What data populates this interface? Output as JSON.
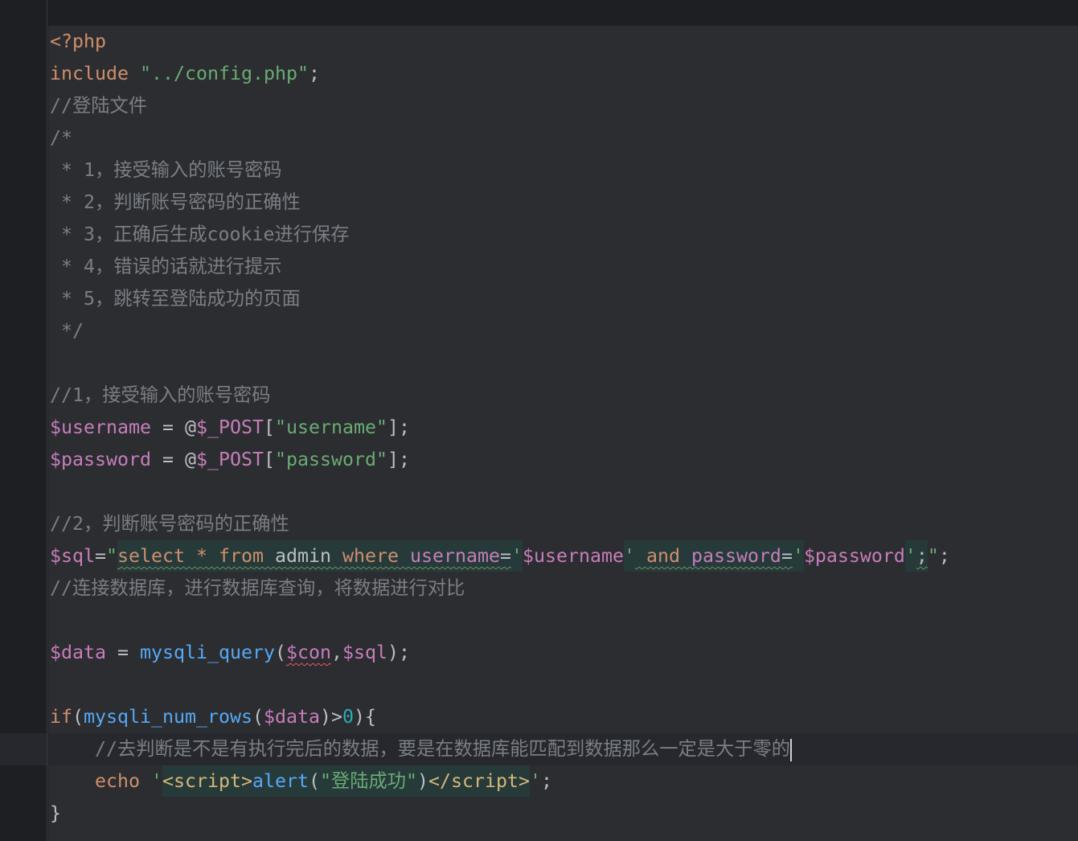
{
  "theme": {
    "outer_bg": "#1e1f22",
    "editor_bg": "#2b2d30",
    "current_line_bg": "#26282e",
    "caret": "#ced0d6",
    "gutter_border": "#393b40"
  },
  "editor": {
    "lines": [
      {
        "tokens": [
          {
            "text": "<?php",
            "fg": "#cf8e6d"
          }
        ]
      },
      {
        "tokens": [
          {
            "text": "include",
            "fg": "#cf8e6d"
          },
          {
            "text": " ",
            "fg": "#bcbec4"
          },
          {
            "text": "\"../config.php\"",
            "fg": "#6aab73"
          },
          {
            "text": ";",
            "fg": "#bcbec4"
          }
        ]
      },
      {
        "tokens": [
          {
            "text": "//登陆文件",
            "fg": "#7a7e85"
          }
        ]
      },
      {
        "tokens": [
          {
            "text": "/*",
            "fg": "#7a7e85"
          }
        ]
      },
      {
        "tokens": [
          {
            "text": " * 1，接受输入的账号密码",
            "fg": "#7a7e85"
          }
        ]
      },
      {
        "tokens": [
          {
            "text": " * 2，判断账号密码的正确性",
            "fg": "#7a7e85"
          }
        ]
      },
      {
        "tokens": [
          {
            "text": " * 3，正确后生成cookie进行保存",
            "fg": "#7a7e85"
          }
        ]
      },
      {
        "tokens": [
          {
            "text": " * 4，错误的话就进行提示",
            "fg": "#7a7e85"
          }
        ]
      },
      {
        "tokens": [
          {
            "text": " * 5，跳转至登陆成功的页面",
            "fg": "#7a7e85"
          }
        ]
      },
      {
        "tokens": [
          {
            "text": " */",
            "fg": "#7a7e85"
          }
        ]
      },
      {
        "tokens": []
      },
      {
        "tokens": [
          {
            "text": "//1，接受输入的账号密码",
            "fg": "#7a7e85"
          }
        ]
      },
      {
        "tokens": [
          {
            "text": "$username",
            "fg": "#c77dbb"
          },
          {
            "text": " = @",
            "fg": "#bcbec4"
          },
          {
            "text": "$_POST",
            "fg": "#c77dbb"
          },
          {
            "text": "[",
            "fg": "#bcbec4"
          },
          {
            "text": "\"username\"",
            "fg": "#6aab73"
          },
          {
            "text": "];",
            "fg": "#bcbec4"
          }
        ]
      },
      {
        "tokens": [
          {
            "text": "$password",
            "fg": "#c77dbb"
          },
          {
            "text": " = @",
            "fg": "#bcbec4"
          },
          {
            "text": "$_POST",
            "fg": "#c77dbb"
          },
          {
            "text": "[",
            "fg": "#bcbec4"
          },
          {
            "text": "\"password\"",
            "fg": "#6aab73"
          },
          {
            "text": "];",
            "fg": "#bcbec4"
          }
        ]
      },
      {
        "tokens": []
      },
      {
        "tokens": [
          {
            "text": "//2，判断账号密码的正确性",
            "fg": "#7a7e85"
          }
        ]
      },
      {
        "tokens": [
          {
            "text": "$sql",
            "fg": "#c77dbb"
          },
          {
            "text": "=",
            "fg": "#bcbec4"
          },
          {
            "text": "\"",
            "fg": "#6aab73"
          },
          {
            "text": "select",
            "fg": "#cf8e6d",
            "bg": "#263a3a",
            "wavy": "#6f8f62"
          },
          {
            "text": " ",
            "fg": "#bcbec4",
            "bg": "#263a3a",
            "wavy": "#6f8f62"
          },
          {
            "text": "*",
            "fg": "#cf8e6d",
            "bg": "#263a3a",
            "wavy": "#6f8f62"
          },
          {
            "text": " ",
            "fg": "#bcbec4",
            "bg": "#263a3a",
            "wavy": "#6f8f62"
          },
          {
            "text": "from",
            "fg": "#cf8e6d",
            "bg": "#263a3a",
            "wavy": "#6f8f62"
          },
          {
            "text": " admin ",
            "fg": "#bcbec4",
            "bg": "#263a3a",
            "wavy": "#6f8f62"
          },
          {
            "text": "where",
            "fg": "#cf8e6d",
            "bg": "#263a3a",
            "wavy": "#6f8f62"
          },
          {
            "text": " ",
            "fg": "#bcbec4",
            "bg": "#263a3a",
            "wavy": "#6f8f62"
          },
          {
            "text": "username",
            "fg": "#c77dbb",
            "bg": "#263a3a",
            "wavy": "#6f8f62"
          },
          {
            "text": "=",
            "fg": "#bcbec4",
            "bg": "#263a3a",
            "wavy": "#6f8f62"
          },
          {
            "text": "'",
            "fg": "#6aab73",
            "bg": "#263a3a"
          },
          {
            "text": "$username",
            "fg": "#c77dbb"
          },
          {
            "text": "'",
            "fg": "#6aab73",
            "bg": "#263a3a"
          },
          {
            "text": " ",
            "fg": "#bcbec4",
            "bg": "#263a3a",
            "wavy": "#6f8f62"
          },
          {
            "text": "and",
            "fg": "#cf8e6d",
            "bg": "#263a3a",
            "wavy": "#6f8f62"
          },
          {
            "text": " ",
            "fg": "#bcbec4",
            "bg": "#263a3a",
            "wavy": "#6f8f62"
          },
          {
            "text": "password",
            "fg": "#c77dbb",
            "bg": "#263a3a",
            "wavy": "#6f8f62"
          },
          {
            "text": "=",
            "fg": "#bcbec4",
            "bg": "#263a3a",
            "wavy": "#6f8f62"
          },
          {
            "text": "'",
            "fg": "#6aab73",
            "bg": "#263a3a"
          },
          {
            "text": "$password",
            "fg": "#c77dbb"
          },
          {
            "text": "'",
            "fg": "#6aab73",
            "bg": "#263a3a"
          },
          {
            "text": ";",
            "fg": "#bcbec4",
            "bg": "#263a3a",
            "wavy": "#6f8f62"
          },
          {
            "text": "\"",
            "fg": "#6aab73"
          },
          {
            "text": ";",
            "fg": "#bcbec4"
          }
        ]
      },
      {
        "tokens": [
          {
            "text": "//连接数据库，进行数据库查询，将数据进行对比",
            "fg": "#7a7e85"
          }
        ]
      },
      {
        "tokens": []
      },
      {
        "tokens": [
          {
            "text": "$data",
            "fg": "#c77dbb"
          },
          {
            "text": " = ",
            "fg": "#bcbec4"
          },
          {
            "text": "mysqli_query",
            "fg": "#56a8f5"
          },
          {
            "text": "(",
            "fg": "#bcbec4"
          },
          {
            "text": "$con",
            "fg": "#c77dbb",
            "wavy": "#f75464"
          },
          {
            "text": ",",
            "fg": "#bcbec4"
          },
          {
            "text": "$sql",
            "fg": "#c77dbb"
          },
          {
            "text": ");",
            "fg": "#bcbec4"
          }
        ]
      },
      {
        "tokens": []
      },
      {
        "tokens": [
          {
            "text": "if",
            "fg": "#cf8e6d"
          },
          {
            "text": "(",
            "fg": "#bcbec4"
          },
          {
            "text": "mysqli_num_rows",
            "fg": "#56a8f5"
          },
          {
            "text": "(",
            "fg": "#bcbec4"
          },
          {
            "text": "$data",
            "fg": "#c77dbb"
          },
          {
            "text": ")>",
            "fg": "#bcbec4"
          },
          {
            "text": "0",
            "fg": "#2aacb8"
          },
          {
            "text": "){",
            "fg": "#bcbec4"
          }
        ]
      },
      {
        "current": true,
        "caret": true,
        "tokens": [
          {
            "text": "    //去判断是不是有执行完后的数据，要是在数据库能匹配到数据那么一定是大于零的",
            "fg": "#7a7e85"
          }
        ]
      },
      {
        "tokens": [
          {
            "text": "    ",
            "fg": "#bcbec4"
          },
          {
            "text": "echo",
            "fg": "#cf8e6d"
          },
          {
            "text": " ",
            "fg": "#bcbec4"
          },
          {
            "text": "'",
            "fg": "#6aab73"
          },
          {
            "text": "<script>",
            "fg": "#d5b778",
            "bg": "#263a3a"
          },
          {
            "text": "alert",
            "fg": "#56a8f5",
            "bg": "#263a3a"
          },
          {
            "text": "(",
            "fg": "#bcbec4",
            "bg": "#263a3a"
          },
          {
            "text": "\"登陆成功\"",
            "fg": "#6aab73",
            "bg": "#263a3a"
          },
          {
            "text": ")",
            "fg": "#bcbec4",
            "bg": "#263a3a"
          },
          {
            "text": "</script>",
            "fg": "#d5b778",
            "bg": "#263a3a"
          },
          {
            "text": "'",
            "fg": "#6aab73"
          },
          {
            "text": ";",
            "fg": "#bcbec4"
          }
        ]
      },
      {
        "tokens": [
          {
            "text": "}",
            "fg": "#bcbec4"
          }
        ]
      }
    ]
  }
}
